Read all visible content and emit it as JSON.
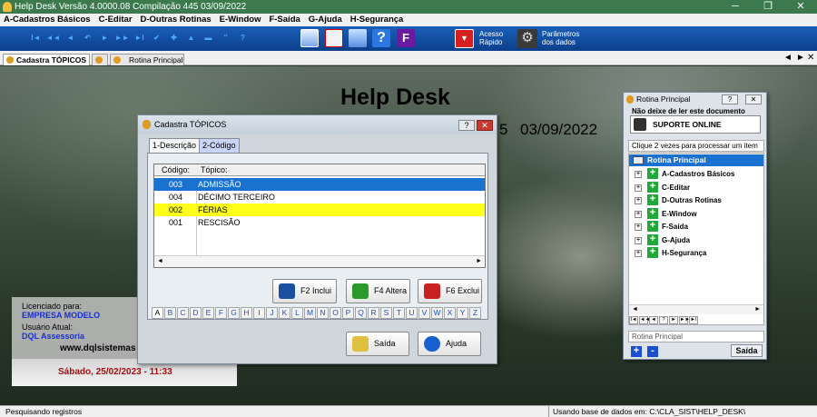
{
  "window": {
    "title": "Help Desk  Versão  4.0000.08 Compilação 445  03/09/2022",
    "minimize": "─",
    "restore": "❐",
    "close": "✕"
  },
  "menu": [
    "A-Cadastros Básicos",
    "C-Editar",
    "D-Outras Rotinas",
    "E-Window",
    "F-Saída",
    "G-Ajuda",
    "H-Segurança"
  ],
  "toolbar": {
    "nav": [
      "I◄",
      "◄◄",
      "◄",
      "↶",
      "►",
      "►►",
      "►I",
      "✔",
      "✚",
      "▲",
      "▬",
      "\"",
      "?"
    ],
    "acesso_rapido": "Acesso\nRápido",
    "acesso_line1": "Acesso",
    "acesso_line2": "Rápido",
    "param_line1": "Parâmetros",
    "param_line2": "dos dados"
  },
  "tabs": {
    "active": "Cadastra TÓPICOS",
    "other": "Rotina Principal",
    "nav_left": "◄",
    "nav_right": "►",
    "close": "✕"
  },
  "desktop": {
    "title": "Help Desk",
    "date_fragment": "5",
    "date": "03/09/2022"
  },
  "license": {
    "licenciado_label": "Licenciado para:",
    "licenciado_value": "EMPRESA MODELO",
    "usuario_label": "Usuário Atual:",
    "usuario_value": "DQL Assessoria",
    "site": "www.dqlsistemas",
    "datetime": "Sábado, 25/02/2023 - 11:33"
  },
  "dialog": {
    "title": "Cadastra TÓPICOS",
    "help": "?",
    "close": "✕",
    "tabs": [
      "1-Descrição",
      "2-Código"
    ],
    "columns": [
      "Código:",
      "Tópico:"
    ],
    "rows": [
      {
        "codigo": "003",
        "topico": "ADMISSÃO"
      },
      {
        "codigo": "004",
        "topico": "DÉCIMO TERCEIRO"
      },
      {
        "codigo": "002",
        "topico": "FÉRIAS"
      },
      {
        "codigo": "001",
        "topico": "RESCISÃO"
      }
    ],
    "scroll_left": "◄",
    "scroll_right": "►",
    "buttons": {
      "inclui": "F2 Inclui",
      "altera": "F4 Altera",
      "exclui": "F6 Exclui",
      "saida": "Saída",
      "ajuda": "Ajuda"
    },
    "letters": [
      "A",
      "B",
      "C",
      "D",
      "E",
      "F",
      "G",
      "H",
      "I",
      "J",
      "K",
      "L",
      "M",
      "N",
      "O",
      "P",
      "Q",
      "R",
      "S",
      "T",
      "U",
      "V",
      "W",
      "X",
      "Y",
      "Z"
    ]
  },
  "rotina": {
    "title": "Rotina Principal",
    "help": "?",
    "close": "✕",
    "warning": "Não deixe de ler este documento",
    "suporte": "SUPORTE ONLINE",
    "hint": "Clique 2 vezes para processar um item",
    "root": "Rotina Principal",
    "items": [
      "A-Cadastros Básicos",
      "C-Editar",
      "D-Outras Rotinas",
      "E-Window",
      "F-Saída",
      "G-Ajuda",
      "H-Segurança"
    ],
    "expand": "+",
    "footer_label": "Rotina Principal",
    "plus": "+",
    "minus": "-",
    "saida": "Saída"
  },
  "status": {
    "left": "Pesquisando registros",
    "right": "Usando base de dados em: C:\\CLA_SIST\\HELP_DESK\\"
  }
}
